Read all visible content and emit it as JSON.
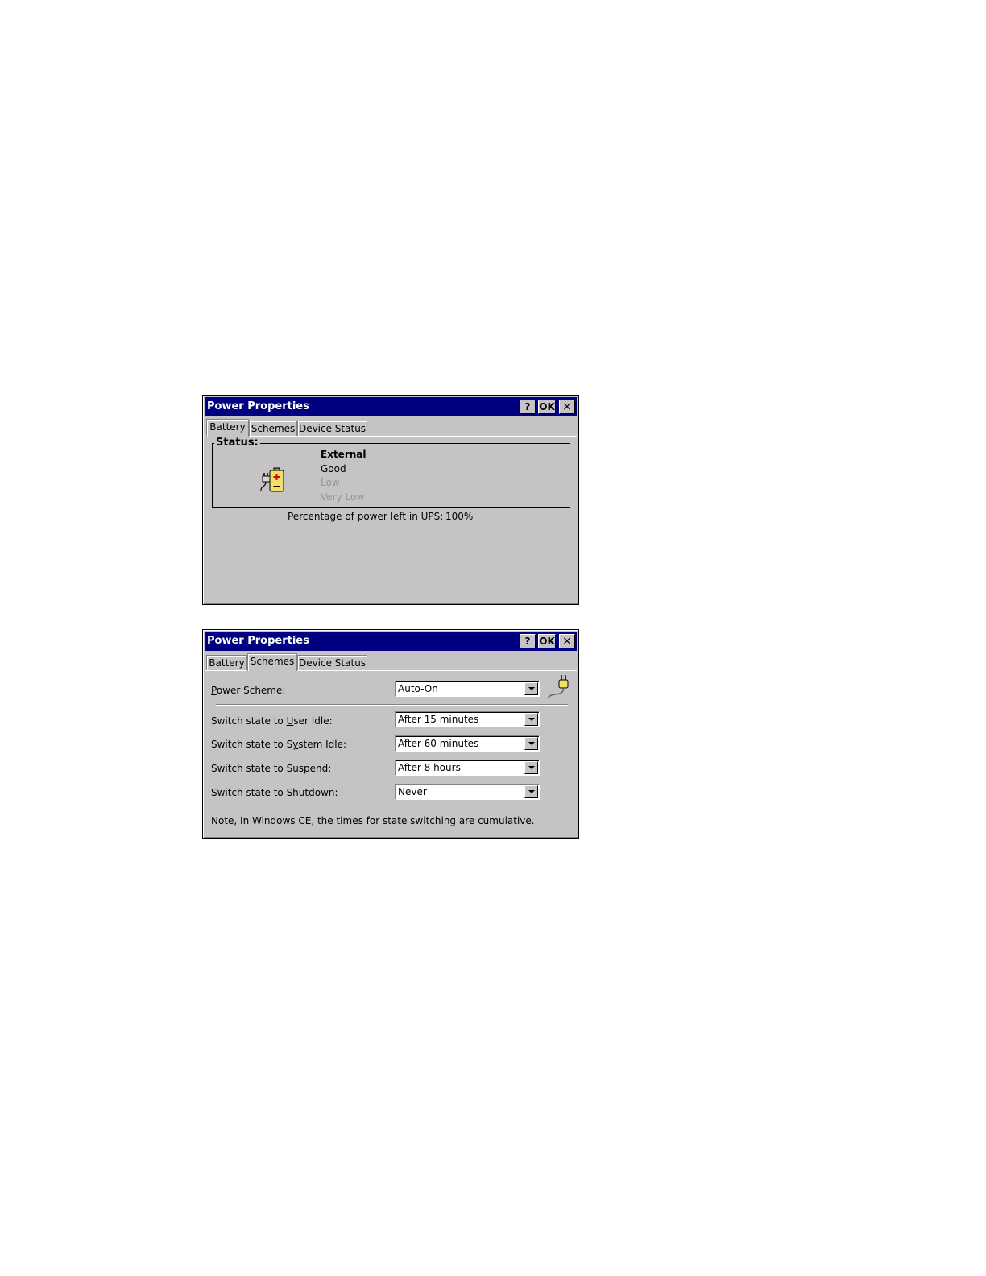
{
  "dialog1": {
    "title": "Power Properties",
    "help_label": "?",
    "ok_label": "OK",
    "close_label": "×",
    "tabs": [
      "Battery",
      "Schemes",
      "Device Status"
    ],
    "active_tab": "Battery",
    "status_group_label": "Status:",
    "status_items": [
      "External",
      "Good",
      "Low",
      "Very Low"
    ],
    "current_status": "External",
    "icon": "battery-plug-icon",
    "percentage_label": "Percentage of power left in UPS:",
    "percentage_value": "100%"
  },
  "dialog2": {
    "title": "Power Properties",
    "help_label": "?",
    "ok_label": "OK",
    "close_label": "×",
    "tabs": [
      "Battery",
      "Schemes",
      "Device Status"
    ],
    "active_tab": "Schemes",
    "icon": "power-plug-icon",
    "power_scheme": {
      "label": "Power Scheme:",
      "value": "Auto-On"
    },
    "user_idle": {
      "label": "Switch state to User Idle:",
      "value": "After 15 minutes"
    },
    "system_idle": {
      "label": "Switch state to System Idle:",
      "value": "After 60 minutes"
    },
    "suspend": {
      "label": "Switch state to Suspend:",
      "value": "After 8 hours"
    },
    "shutdown": {
      "label": "Switch state to Shutdown:",
      "value": "Never"
    },
    "note": "Note, In Windows CE, the times for state switching are cumulative."
  }
}
